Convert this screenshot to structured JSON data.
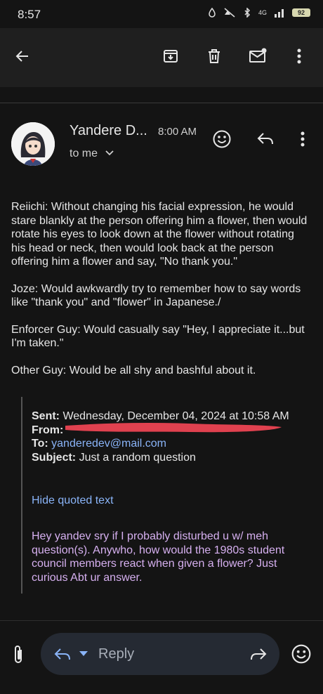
{
  "status_bar": {
    "time": "8:57",
    "battery": "92",
    "network": "4G"
  },
  "email": {
    "sender": "Yandere D...",
    "time": "8:00 AM",
    "recipient": "to me",
    "body": [
      "Reiichi: Without changing his facial expression, he would stare blankly at the person offering him a flower, then would rotate his eyes to look down at the flower without rotating his head or neck, then would look back at the person offering him a flower and say, \"No thank you.\"",
      "Joze: Would awkwardly try to remember how to say words like \"thank you\" and \"flower\" in Japanese./",
      "Enforcer Guy: Would casually say \"Hey, I appreciate it...but I'm taken.\"",
      "Other Guy: Would be all shy and bashful about it."
    ]
  },
  "quoted": {
    "sent_label": "Sent:",
    "sent_value": "Wednesday, December 04, 2024 at 10:58 AM",
    "from_label": "From:",
    "to_label": "To:",
    "to_value": "yanderedev@mail.com",
    "subject_label": "Subject:",
    "subject_value": "Just a random question",
    "hide_label": "Hide quoted text",
    "message": "Hey yandev sry if I probably disturbed u w/ meh question(s). Anywho, how would the 1980s student council members react when given a flower? Just curious Abt ur answer."
  },
  "composer": {
    "reply_label": "Reply"
  },
  "icons": [
    "back-arrow-icon",
    "archive-icon",
    "delete-icon",
    "mark-unread-icon",
    "more-vert-icon",
    "emoji-icon",
    "reply-icon",
    "attachment-icon",
    "forward-icon",
    "chevron-down-icon"
  ],
  "colors": {
    "link": "#8ab4f8",
    "quoted_text": "#d6b0f0",
    "redaction": "#e0414f"
  }
}
